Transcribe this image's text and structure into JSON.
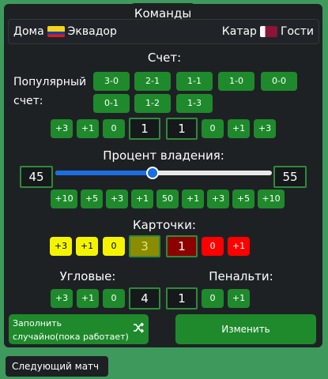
{
  "header": {
    "title": "Команды"
  },
  "teams": {
    "home_label": "Дома",
    "home_team": "Эквадор",
    "away_team": "Катар",
    "away_label": "Гости",
    "home_flag_colors": [
      "#f5d418",
      "#1f3ca6",
      "#d81e1e"
    ],
    "away_flag_color": "#8a1538"
  },
  "score": {
    "title": "Счет:",
    "popular_label": "Популярный счет:",
    "popular": [
      "3-0",
      "2-1",
      "1-1",
      "1-0",
      "0-0",
      "0-1",
      "1-2",
      "1-3"
    ],
    "home_adjust": [
      "+3",
      "+1",
      "0"
    ],
    "home_value": "1",
    "away_value": "1",
    "away_adjust": [
      "0",
      "+1",
      "+3"
    ]
  },
  "possession": {
    "title": "Процент владения:",
    "home_value": "45",
    "away_value": "55",
    "slider_value": 45,
    "buttons": [
      "+10",
      "+5",
      "+3",
      "+1",
      "50",
      "+1",
      "+3",
      "+5",
      "+10"
    ]
  },
  "cards": {
    "title": "Карточки:",
    "yellow_adjust": [
      "+3",
      "+1",
      "0"
    ],
    "yellow_value": "3",
    "red_value": "1",
    "red_adjust": [
      "0",
      "+1"
    ]
  },
  "corners": {
    "title": "Угловые:",
    "adjust": [
      "+3",
      "+1",
      "0"
    ],
    "value": "4"
  },
  "penalties": {
    "title": "Пенальти:",
    "value": "1",
    "adjust": [
      "0",
      "+1"
    ]
  },
  "actions": {
    "random_fill": "Заполнить случайно(пока работает)",
    "change": "Изменить",
    "next_match": "Следующий матч"
  }
}
